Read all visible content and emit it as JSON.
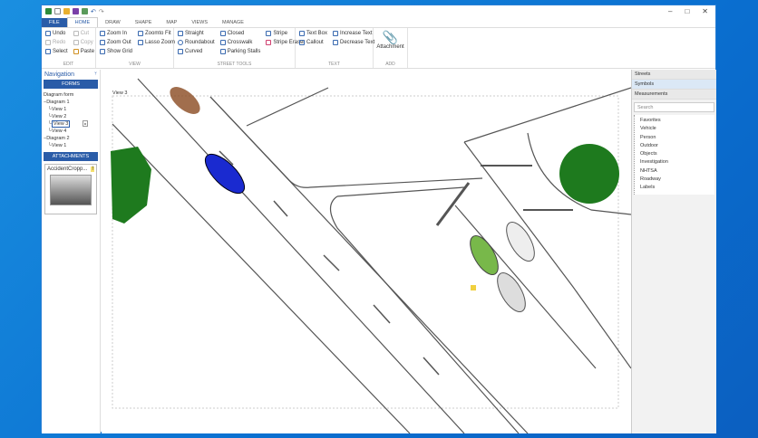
{
  "quick_access": [
    "app-icon",
    "new-icon",
    "open-icon",
    "save-icon",
    "save-as-icon",
    "undo-icon",
    "redo-icon"
  ],
  "window_controls": {
    "minimize": "–",
    "maximize": "□",
    "close": "✕"
  },
  "tabs": [
    "FILE",
    "HOME",
    "DRAW",
    "SHAPE",
    "MAP",
    "VIEWS",
    "MANAGE"
  ],
  "ribbon": {
    "edit": {
      "label": "EDIT",
      "items": [
        "Undo",
        "Redo",
        "Select",
        "Cut",
        "Copy",
        "Paste"
      ]
    },
    "view": {
      "label": "VIEW",
      "items": [
        "Zoom In",
        "Zoom Out",
        "Show Grid",
        "Zoomto Fit",
        "Lasso Zoom"
      ]
    },
    "street": {
      "label": "STREET TOOLS",
      "items": [
        "Straight",
        "Roundabout",
        "Curved",
        "Closed",
        "Crosswalk",
        "Parking Stalls",
        "Stripe",
        "Stripe Eraser"
      ]
    },
    "text": {
      "label": "TEXT",
      "items": [
        "Text Box",
        "Callout",
        "Increase Text",
        "Decrease Text"
      ]
    },
    "add": {
      "label": "ADD",
      "items": [
        "Attachment"
      ]
    }
  },
  "navigation": {
    "title": "Navigation",
    "pin": "📌",
    "forms_label": "FORMS",
    "tree": [
      "Diagram form",
      "Diagram 1",
      "View 1",
      "View 2",
      "View 3",
      "View 4",
      "Diagram 2",
      "View 1"
    ],
    "attachments_label": "ATTACHMENTS",
    "attachment_name": "AccidentCropp..."
  },
  "canvas": {
    "view_label": "View 3"
  },
  "right_panel": {
    "sections": [
      "Streets",
      "Symbols",
      "Measurements"
    ],
    "search_placeholder": "Search",
    "items": [
      "Favorites",
      "Vehicle",
      "Person",
      "Outdoor",
      "Objects",
      "Investigation",
      "NHTSA",
      "Roadway",
      "Labels"
    ]
  },
  "colors": {
    "accent": "#2a5ca8",
    "tree_green": "#1e7a1e"
  }
}
